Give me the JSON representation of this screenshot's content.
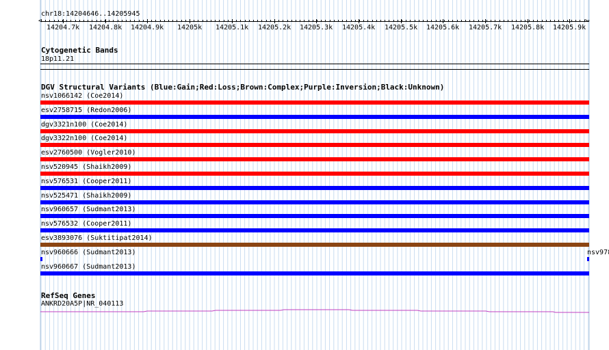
{
  "colors": {
    "gain": "#0000ff",
    "loss": "#ff0000",
    "complex": "#8b4513",
    "gene": "#c040c0"
  },
  "ruler": {
    "location": "chr18:14204646..14205945",
    "tick_labels": [
      "14204.7k",
      "14204.8k",
      "14204.9k",
      "14205k",
      "14205.1k",
      "14205.2k",
      "14205.3k",
      "14205.4k",
      "14205.5k",
      "14205.6k",
      "14205.7k",
      "14205.8k",
      "14205.9k"
    ]
  },
  "cytoband": {
    "title": "Cytogenetic Bands",
    "band_label": "18p11.21"
  },
  "dgv": {
    "title": "DGV Structural Variants (Blue:Gain;Red:Loss;Brown:Complex;Purple:Inversion;Black:Unknown)",
    "variants": [
      {
        "label": "nsv1066142 (Coe2014)",
        "type": "loss"
      },
      {
        "label": "esv2758715 (Redon2006)",
        "type": "gain"
      },
      {
        "label": "dgv3321n100 (Coe2014)",
        "type": "loss"
      },
      {
        "label": "dgv3322n100 (Coe2014)",
        "type": "loss"
      },
      {
        "label": "esv2760500 (Vogler2010)",
        "type": "loss"
      },
      {
        "label": "nsv520945 (Shaikh2009)",
        "type": "loss"
      },
      {
        "label": "nsv576531 (Cooper2011)",
        "type": "gain"
      },
      {
        "label": "nsv525471 (Shaikh2009)",
        "type": "gain"
      },
      {
        "label": "nsv960657 (Sudmant2013)",
        "type": "gain"
      },
      {
        "label": "nsv576532 (Cooper2011)",
        "type": "gain"
      },
      {
        "label": "esv3893076 (Suktitipat2014)",
        "type": "complex"
      },
      {
        "label": "nsv960666 (Sudmant2013)",
        "type": "gain",
        "partial": true,
        "right_label": "nsv978"
      },
      {
        "label": "nsv960667 (Sudmant2013)",
        "type": "gain"
      }
    ]
  },
  "refseq": {
    "title": "RefSeq Genes",
    "gene_label": "ANKRD20A5P|NR_040113"
  }
}
